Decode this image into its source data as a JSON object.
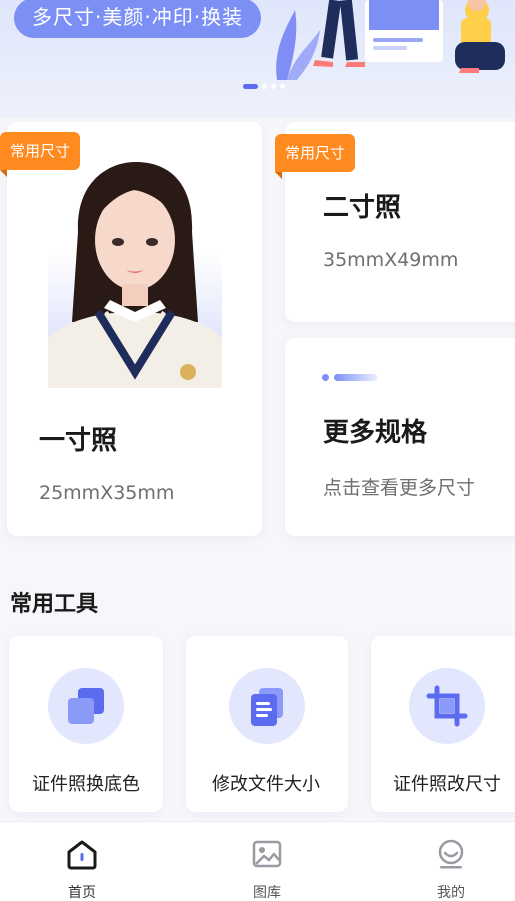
{
  "banner": {
    "text": "多尺寸·美颜·冲印·换装",
    "slides_total": 4,
    "active_slide": 1
  },
  "cards": {
    "one_inch": {
      "tag": "常用尺寸",
      "title": "一寸照",
      "size": "25mmX35mm"
    },
    "two_inch": {
      "tag": "常用尺寸",
      "title": "二寸照",
      "size": "35mmX49mm"
    },
    "more": {
      "title": "更多规格",
      "subtitle": "点击查看更多尺寸"
    }
  },
  "tools": {
    "section_title": "常用工具",
    "items": [
      {
        "label": "证件照换底色",
        "icon": "layers-icon"
      },
      {
        "label": "修改文件大小",
        "icon": "document-icon"
      },
      {
        "label": "证件照改尺寸",
        "icon": "crop-icon"
      }
    ]
  },
  "nav": {
    "items": [
      {
        "label": "首页",
        "icon": "home-icon",
        "active": true
      },
      {
        "label": "图库",
        "icon": "gallery-icon",
        "active": false
      },
      {
        "label": "我的",
        "icon": "profile-icon",
        "active": false
      }
    ]
  },
  "colors": {
    "accent": "#5b6cf0",
    "accent_light": "#e3e7fd",
    "tag_orange": "#ff8a1f",
    "banner_pill": "#7b8ff5"
  }
}
